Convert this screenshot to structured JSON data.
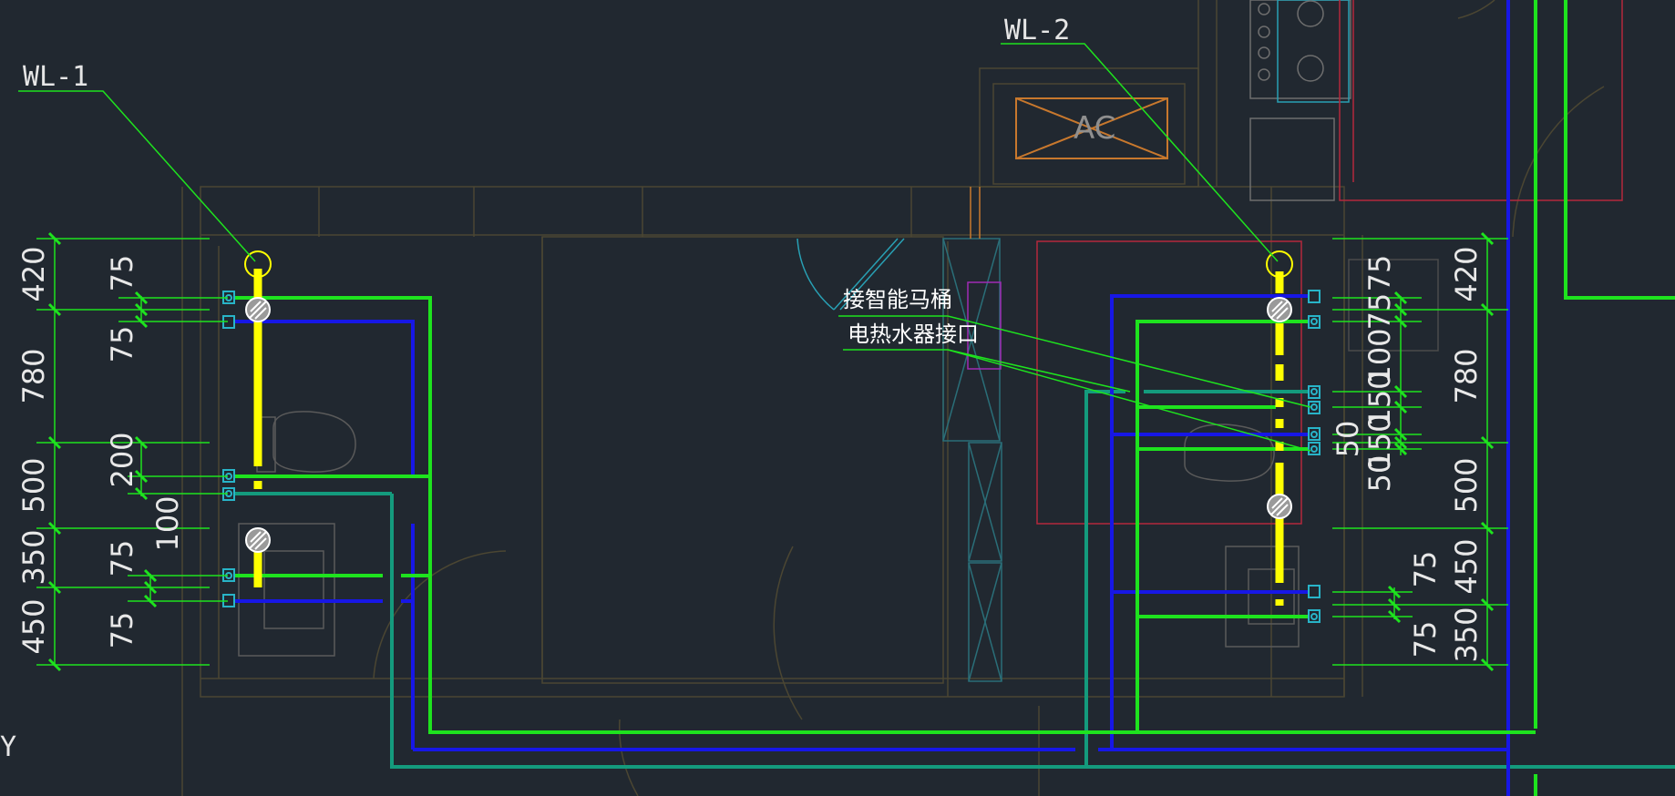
{
  "labels": {
    "wl1": "WL-1",
    "wl2": "WL-2",
    "ac": "AC",
    "toilet": "接智能马桶",
    "heater": "电热水器接口",
    "axis": "Y"
  },
  "left_dims": {
    "outer": [
      "420",
      "780",
      "500",
      "350",
      "450"
    ],
    "inner": [
      "75",
      "75",
      "200",
      "100",
      "75",
      "75"
    ]
  },
  "right_dims": {
    "outer": [
      "420",
      "780",
      "500",
      "450",
      "350"
    ],
    "inner": [
      "75",
      "75",
      "100",
      "150",
      "50",
      "150",
      "50",
      "75",
      "75"
    ]
  },
  "colors": {
    "background": "#212830",
    "green": "#1ee31e",
    "blue": "#1717e6",
    "yellow": "#ffff00",
    "teal": "#149b7d",
    "cyan": "#28b4c8",
    "orange": "#c8782d",
    "red": "#b4283c",
    "dim_text": "#e8e8e8",
    "wall": "#4b4632"
  }
}
